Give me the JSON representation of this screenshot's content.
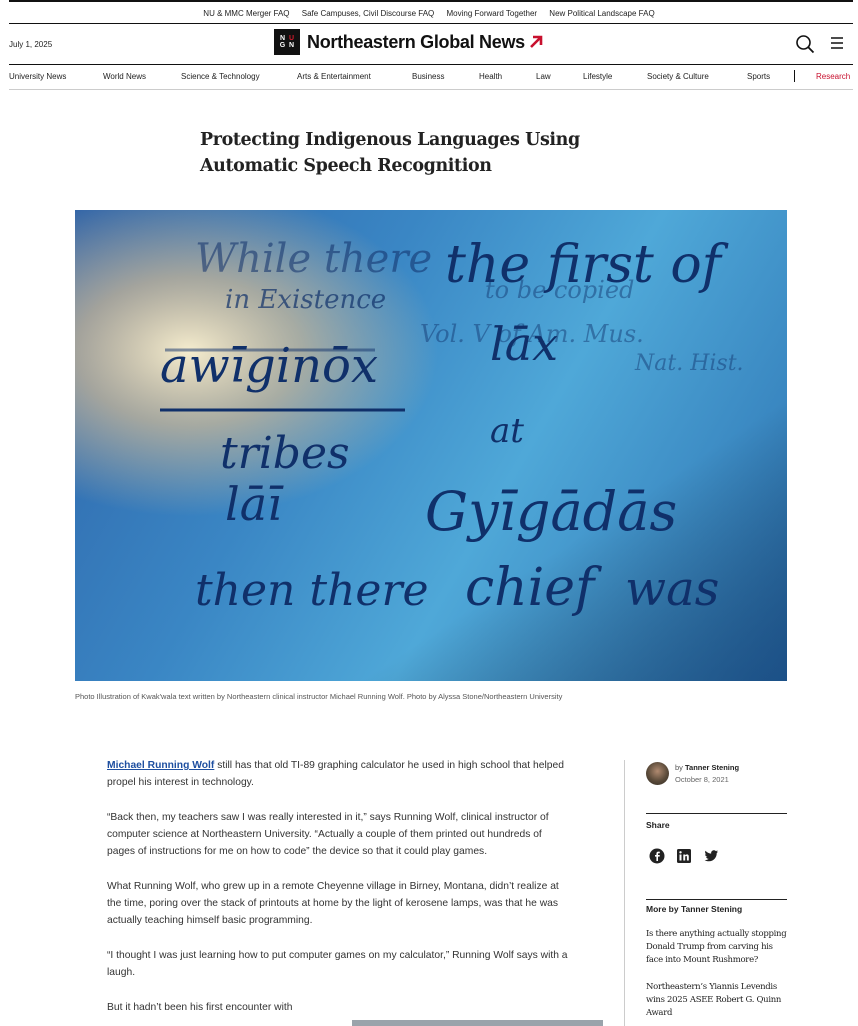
{
  "faq_links": [
    "NU & MMC Merger FAQ",
    "Safe Campuses, Civil Discourse FAQ",
    "Moving Forward Together",
    "New Political Landscape FAQ"
  ],
  "header": {
    "date": "July 1, 2025",
    "logo_mark": [
      "N",
      "U",
      "G",
      "N"
    ],
    "site_name": "Northeastern Global News",
    "icons": {
      "search": "search-icon",
      "menu": "hamburger-menu-icon"
    }
  },
  "nav": [
    "University News",
    "World News",
    "Science & Technology",
    "Arts & Entertainment",
    "Business",
    "Health",
    "Law",
    "Lifestyle",
    "Society & Culture",
    "Sports",
    "Research"
  ],
  "article": {
    "title": "Protecting Indigenous Languages Using Automatic Speech Recognition",
    "caption": "Photo Illustration of Kwak'wala text written by Northeastern clinical instructor Michael Running Wolf. Photo by Alyssa Stone/Northeastern University",
    "hero_text": [
      "While there",
      "the first of",
      "in Existence",
      "to be copied",
      "Vol. V of Am. Mus.",
      "Nat. Hist.",
      "awīginōx",
      "lāx",
      "tribes",
      "at",
      "lāī",
      "Gyīgādās",
      "then there",
      "chief",
      "was"
    ],
    "paragraphs": [
      {
        "link": "Michael Running Wolf",
        "text": " still has that old TI-89 graphing calculator he used in high school that helped propel his interest in technology."
      },
      {
        "link": "",
        "text": "“Back then, my teachers saw I was really interested in it,” says Running Wolf, clinical instructor of computer science at Northeastern University. “Actually a couple of them printed out hundreds of pages of instructions for me on how to code” the device so that it could play games."
      },
      {
        "link": "",
        "text": "What Running Wolf, who grew up in a remote Cheyenne village in Birney, Montana, didn’t realize at the time, poring over the stack of printouts at home by the light of kerosene lamps, was that he was actually teaching himself basic programming."
      },
      {
        "link": "",
        "text": "“I thought I was just learning how to put computer games on my calculator,” Running Wolf says with a laugh."
      },
      {
        "link": "",
        "text": "But it hadn’t been his first encounter with"
      }
    ]
  },
  "sidebar": {
    "by_label": "by",
    "author": "Tanner Stening",
    "date": "October 8, 2021",
    "share_label": "Share",
    "social_icons": [
      "facebook-icon",
      "linkedin-icon",
      "twitter-icon"
    ],
    "more_label": "More by Tanner Stening",
    "more_items": [
      "Is there anything actually stopping Donald Trump from carving his face into Mount Rushmore?",
      "Northeastern’s Yiannis Levendis wins 2025 ASEE Robert G. Quinn Award"
    ]
  },
  "colors": {
    "accent": "#c8102e",
    "link": "#1e4fa0",
    "text": "#222222"
  }
}
